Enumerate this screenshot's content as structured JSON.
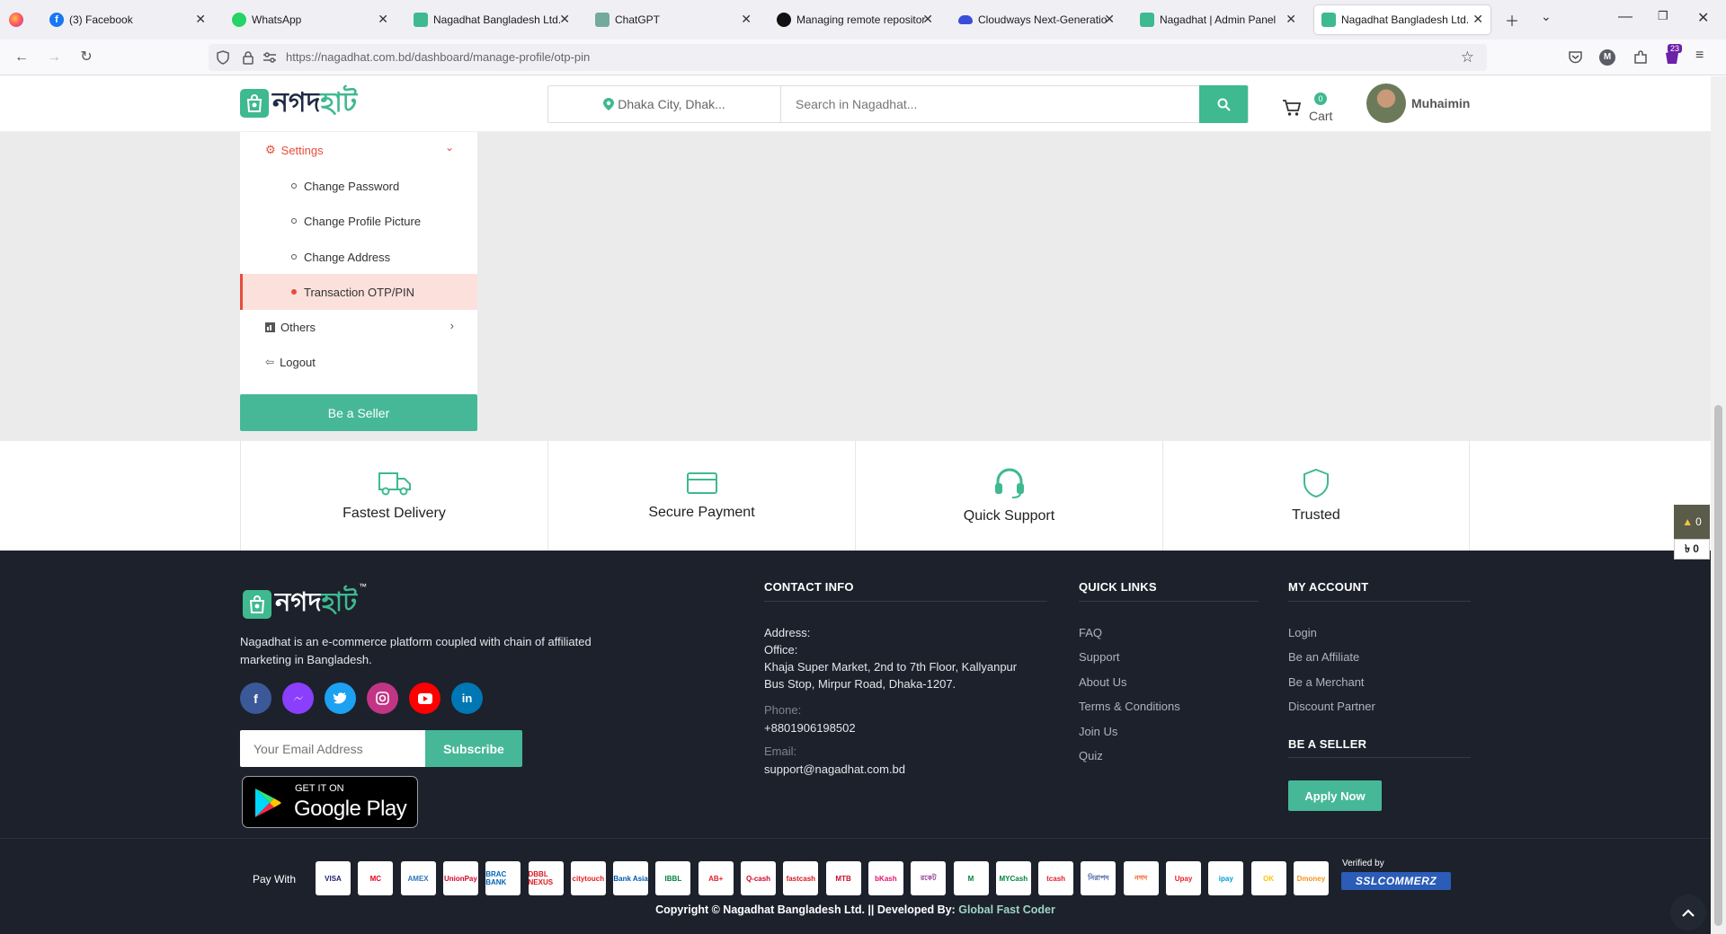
{
  "browser": {
    "tabs": [
      {
        "label": "(3) Facebook",
        "icon": "facebook-icon",
        "color": "#1877f2"
      },
      {
        "label": "WhatsApp",
        "icon": "whatsapp-icon",
        "color": "#25d366"
      },
      {
        "label": "Nagadhat Bangladesh Ltd.",
        "icon": "nagadhat-icon",
        "color": "#3fb98f"
      },
      {
        "label": "ChatGPT",
        "icon": "chatgpt-icon",
        "color": "#74aa9c"
      },
      {
        "label": "Managing remote repositor",
        "icon": "github-icon",
        "color": "#111111"
      },
      {
        "label": "Cloudways Next-Generatio",
        "icon": "cloudways-icon",
        "color": "#3b4dd8"
      },
      {
        "label": "Nagadhat | Admin Panel",
        "icon": "nagadhat-icon",
        "color": "#3fb98f"
      },
      {
        "label": "Nagadhat Bangladesh Ltd.",
        "icon": "nagadhat-icon",
        "color": "#3fb98f"
      }
    ],
    "url_host": "https://nagadhat.com.bd",
    "url_path": "/dashboard/manage-profile/otp-pin",
    "extension_badge": "23",
    "account_initial": "M"
  },
  "header": {
    "logo_text_a": "নগদ",
    "logo_text_b": "হাট",
    "location": "Dhaka City, Dhak...",
    "search_placeholder": "Search in Nagadhat...",
    "cart_count": "0",
    "cart_label": "Cart",
    "user_name": "Muhaimin"
  },
  "sidebar": {
    "settings_label": "Settings",
    "items": [
      {
        "label": "Change Password"
      },
      {
        "label": "Change Profile Picture"
      },
      {
        "label": "Change Address"
      },
      {
        "label": "Transaction OTP/PIN"
      }
    ],
    "others_label": "Others",
    "logout_label": "Logout",
    "be_seller": "Be a Seller"
  },
  "features": [
    {
      "label": "Fastest Delivery",
      "icon": "truck-icon"
    },
    {
      "label": "Secure Payment",
      "icon": "credit-card-icon"
    },
    {
      "label": "Quick Support",
      "icon": "headset-icon"
    },
    {
      "label": "Trusted",
      "icon": "shield-icon"
    }
  ],
  "footer": {
    "tm": "™",
    "description_line1": "Nagadhat is an e-commerce platform coupled with chain of affiliated",
    "description_line2": "marketing in Bangladesh.",
    "email_placeholder": "Your Email Address",
    "subscribe": "Subscribe",
    "gplay_top": "GET IT ON",
    "gplay_bottom": "Google Play",
    "contact": {
      "heading": "CONTACT INFO",
      "address_label": "Address:",
      "office_label": "Office:",
      "address_line1": "Khaja Super Market, 2nd to 7th Floor, Kallyanpur",
      "address_line2": "Bus Stop, Mirpur Road, Dhaka-1207.",
      "phone_label": "Phone:",
      "phone": "+8801906198502",
      "email_label": "Email:",
      "email": "support@nagadhat.com.bd"
    },
    "quick_links": {
      "heading": "QUICK LINKS",
      "links": [
        "FAQ",
        "Support",
        "About Us",
        "Terms & Conditions",
        "Join Us",
        "Quiz"
      ]
    },
    "my_account": {
      "heading": "MY ACCOUNT",
      "links": [
        "Login",
        "Be an Affiliate",
        "Be a Merchant",
        "Discount Partner"
      ]
    },
    "be_seller": {
      "heading": "BE A SELLER",
      "button": "Apply Now"
    }
  },
  "bottom": {
    "pay_with": "Pay With",
    "payment_methods": [
      "VISA",
      "MC",
      "AMEX",
      "UnionPay",
      "BRAC BANK",
      "DBBL NEXUS",
      "citytouch",
      "Bank Asia",
      "IBBL",
      "AB+",
      "Q-cash",
      "fastcash",
      "MTB",
      "bKash",
      "রকেট",
      "M",
      "MYCash",
      "tcash",
      "নিরাপদ",
      "নগদ",
      "Upay",
      "ipay",
      "OK",
      "Dmoney"
    ],
    "verified_by": "Verified by",
    "sslcommerz": "SSLCOMMERZ",
    "copyright": "Copyright © Nagadhat Bangladesh Ltd. || Developed By:",
    "developer": "Global Fast Coder"
  },
  "floating_cart": {
    "items": "0",
    "amount": "৳ 0"
  },
  "colors": {
    "brand": "#3fb98f",
    "active_menu": "#e74c3c",
    "footer_bg": "#1c212c"
  }
}
